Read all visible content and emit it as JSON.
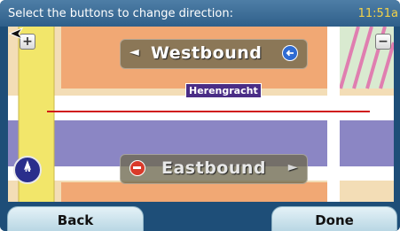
{
  "header": {
    "instruction": "Select the buttons to change direction:",
    "clock": "11:51a"
  },
  "map": {
    "zoom_in_symbol": "+",
    "zoom_out_symbol": "−",
    "street_name": "Herengracht",
    "compass_label": "N",
    "compass_icon": "compass-icon",
    "position_icon": "position-arrow-icon"
  },
  "directions": {
    "westbound": {
      "label": "Westbound",
      "arrow": "◄",
      "icon": "circle-left-arrow-icon",
      "selected": true
    },
    "eastbound": {
      "label": "Eastbound",
      "arrow": "►",
      "icon": "no-entry-icon",
      "selected": false
    }
  },
  "footer": {
    "back_label": "Back",
    "done_label": "Done"
  },
  "colors": {
    "header_bg": "#3a6a94",
    "clock": "#f3d24a",
    "route_line": "#d01818",
    "street_tag_bg": "#4a2d86",
    "road_purple": "#8b86c4",
    "road_yellow": "#f2e66a",
    "map_bg": "#f3ddb6",
    "button_bg": "#c8e0ea"
  }
}
